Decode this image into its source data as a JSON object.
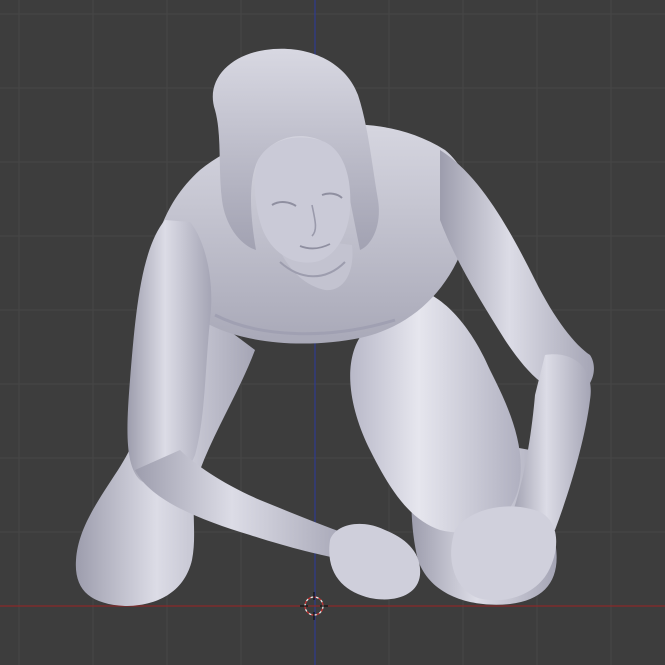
{
  "viewport": {
    "background": "#3d3d3d",
    "grid_color": "#474747",
    "x_axis_color": "#8a2a2a",
    "z_axis_color": "#2e3b8f",
    "model_color": "#c9c9d6",
    "model": "kneeling-human-figure"
  },
  "icons": {
    "cursor": "3d-cursor-icon"
  }
}
